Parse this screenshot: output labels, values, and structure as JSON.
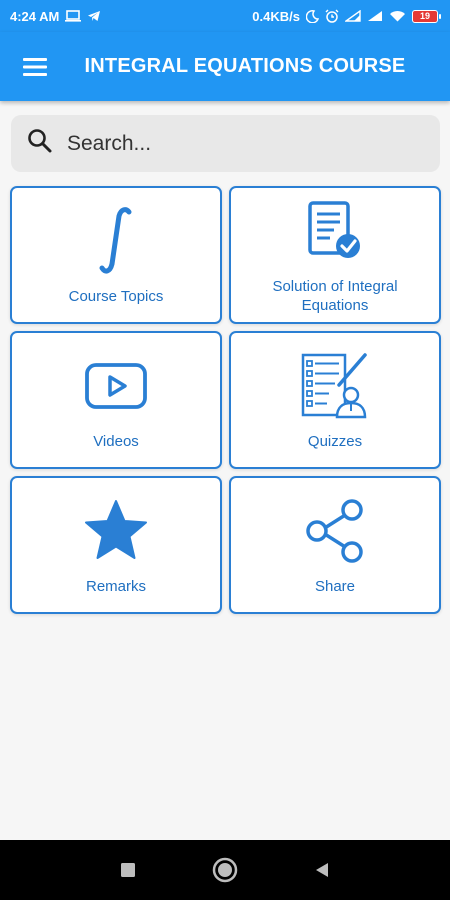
{
  "status_bar": {
    "time": "4:24 AM",
    "net_speed": "0.4KB/s",
    "battery_level": "19",
    "icons": [
      "laptop-icon",
      "telegram-icon",
      "moon-icon",
      "alarm-icon",
      "signal-icon",
      "signal-icon",
      "wifi-icon",
      "battery-icon"
    ]
  },
  "app_bar": {
    "title": "INTEGRAL EQUATIONS COURSE",
    "menu_icon": "hamburger-menu-icon"
  },
  "search": {
    "placeholder": "Search...",
    "value": "",
    "icon": "search-icon"
  },
  "cards": [
    {
      "label": "Course Topics",
      "icon": "integral-icon"
    },
    {
      "label": "Solution of Integral Equations",
      "icon": "document-check-icon"
    },
    {
      "label": "Videos",
      "icon": "video-play-icon"
    },
    {
      "label": "Quizzes",
      "icon": "quiz-icon"
    },
    {
      "label": "Remarks",
      "icon": "star-icon"
    },
    {
      "label": "Share",
      "icon": "share-icon"
    }
  ],
  "nav_bar": {
    "buttons": [
      "recents-icon",
      "home-icon",
      "back-icon"
    ]
  },
  "colors": {
    "primary": "#2196f3",
    "accent": "#2a7fd4",
    "label": "#1f6fc0",
    "background": "#f6f6f6"
  }
}
